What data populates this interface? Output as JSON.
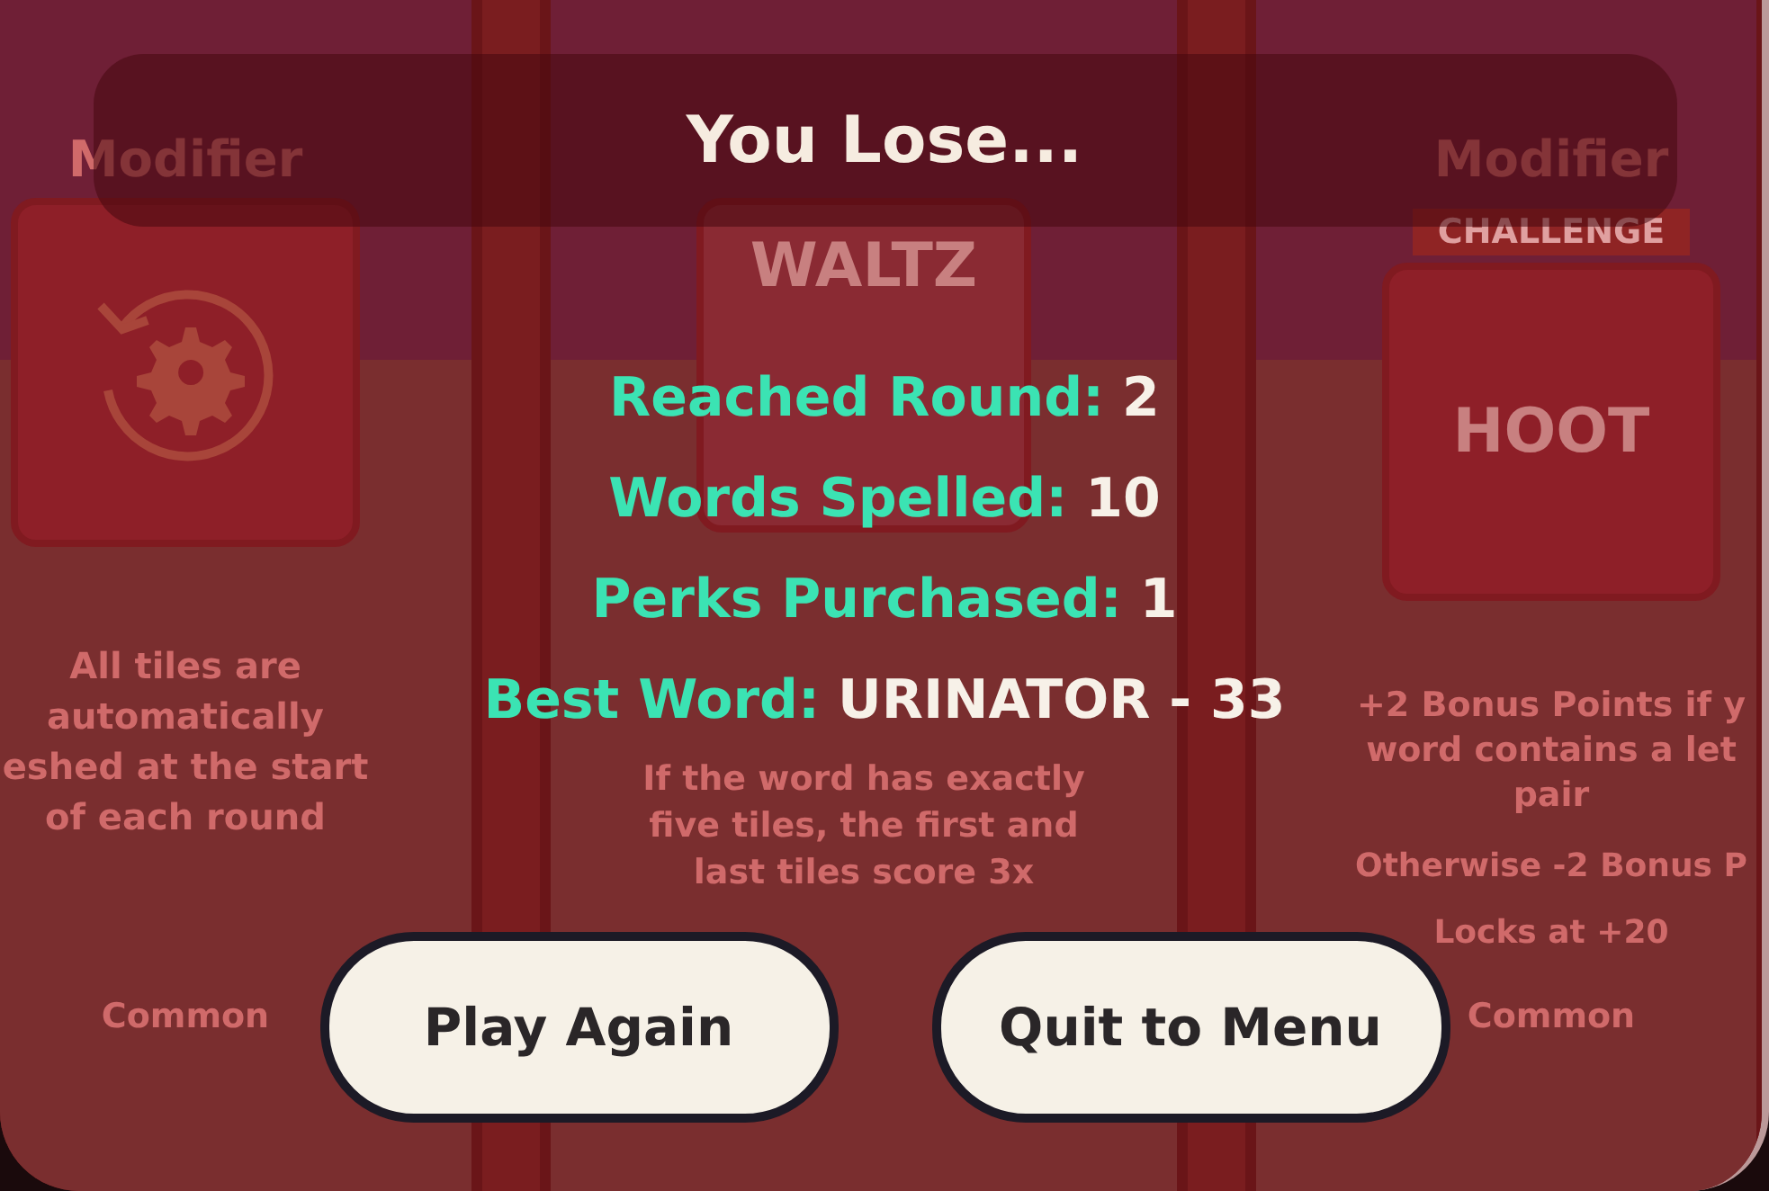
{
  "cards": [
    {
      "kind": "perk",
      "header": "Modifier",
      "description": "All tiles are\nautomatically\neshed at the start\nof each round",
      "rarity": "Common"
    },
    {
      "kind": "word",
      "tile": "WALTZ",
      "description": "If the word has exactly\nfive tiles, the first and\nlast tiles score 3x"
    },
    {
      "kind": "challenge",
      "header": "Modifier",
      "badge": "CHALLENGE",
      "tile": "HOOT",
      "description": "+2 Bonus Points if y\nword contains a let\npair",
      "notes": [
        "Otherwise -2 Bonus P",
        "Locks at +20"
      ],
      "rarity": "Common"
    }
  ],
  "dialog": {
    "title": "You Lose...",
    "stats": [
      {
        "label": "Reached Round:",
        "value": "2"
      },
      {
        "label": "Words Spelled:",
        "value": "10"
      },
      {
        "label": "Perks Purchased:",
        "value": "1"
      },
      {
        "label": "Best Word:",
        "value": "URINATOR - 33"
      }
    ],
    "buttons": [
      "Play Again",
      "Quit to Menu"
    ]
  }
}
